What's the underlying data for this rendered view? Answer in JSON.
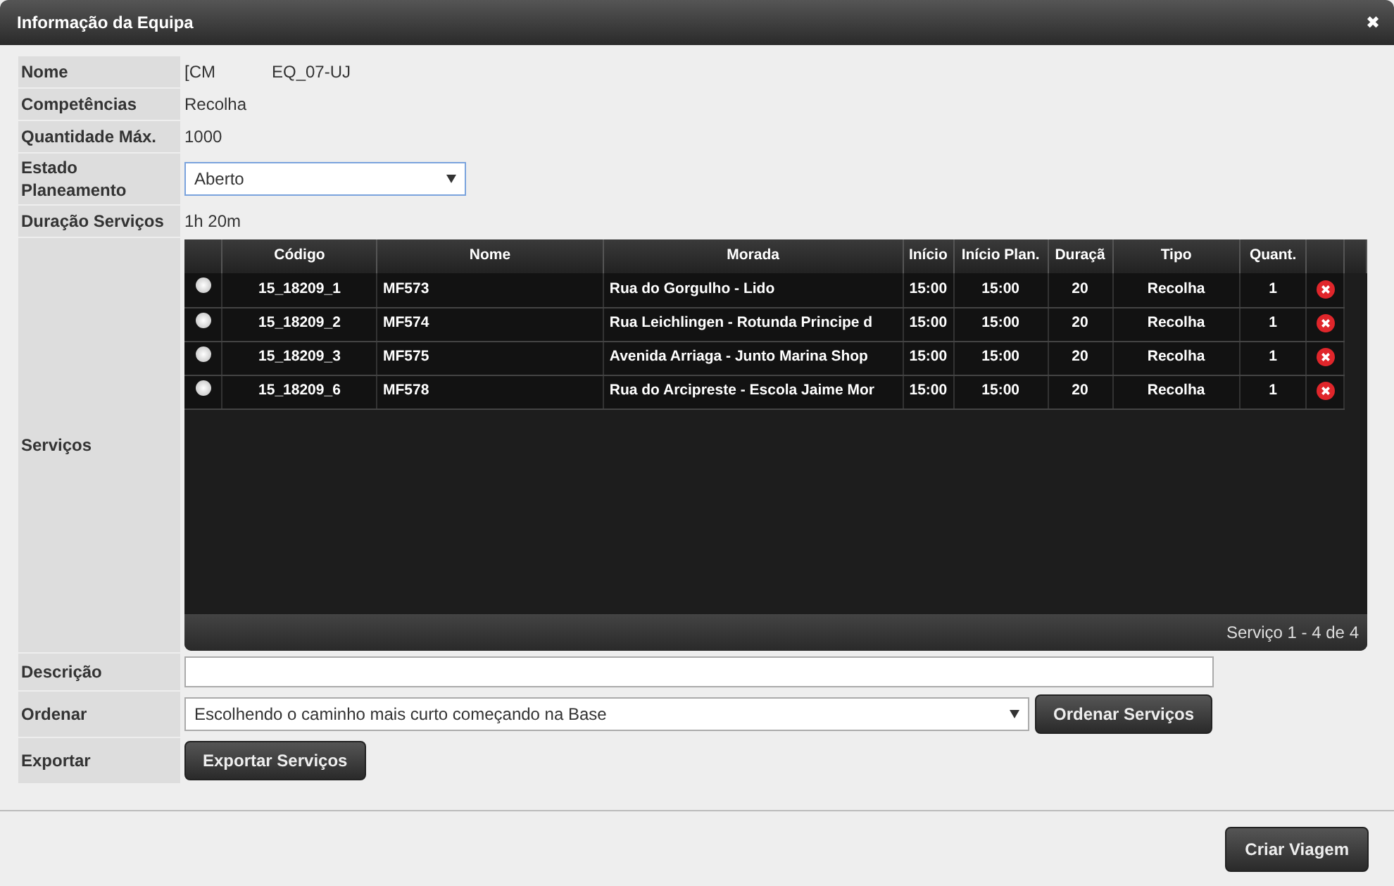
{
  "window": {
    "title": "Informação da Equipa",
    "close": "✖"
  },
  "fields": [
    {
      "label": "Nome",
      "kind": "text",
      "values": [
        "[CM",
        "EQ_07-UJ"
      ]
    },
    {
      "label": "Competências",
      "kind": "text",
      "values": [
        "Recolha"
      ]
    },
    {
      "label": "Quantidade Máx.",
      "kind": "text",
      "values": [
        "1000"
      ]
    },
    {
      "label": "Estado Planeamento",
      "kind": "select",
      "value": "Aberto"
    },
    {
      "label": "Duração Serviços",
      "kind": "text",
      "values": [
        "1h 20m"
      ]
    }
  ],
  "services": {
    "label": "Serviços",
    "columns": [
      "Código",
      "Nome",
      "Morada",
      "Início",
      "Início Plan.",
      "Duraçã",
      "Tipo",
      "Quant."
    ],
    "rows": [
      {
        "selected": false,
        "cells": [
          "15_18209_1",
          "MF573",
          "Rua do Gorgulho - Lido",
          "15:00",
          "15:00",
          "20",
          "Recolha",
          "1"
        ]
      },
      {
        "selected": false,
        "cells": [
          "15_18209_2",
          "MF574",
          "Rua Leichlingen - Rotunda Principe d",
          "15:00",
          "15:00",
          "20",
          "Recolha",
          "1"
        ]
      },
      {
        "selected": false,
        "cells": [
          "15_18209_3",
          "MF575",
          "Avenida Arriaga - Junto Marina Shop",
          "15:00",
          "15:00",
          "20",
          "Recolha",
          "1"
        ]
      },
      {
        "selected": false,
        "cells": [
          "15_18209_6",
          "MF578",
          "Rua do Arcipreste - Escola Jaime Mor",
          "15:00",
          "15:00",
          "20",
          "Recolha",
          "1"
        ]
      }
    ],
    "pager": "Serviço 1 - 4 de 4"
  },
  "description": {
    "label": "Descrição"
  },
  "order": {
    "label": "Ordenar",
    "value": "Escolhendo o caminho mais curto começando na Base",
    "button": "Ordenar Serviços"
  },
  "export": {
    "label": "Exportar",
    "button": "Exportar Serviços"
  },
  "footer": {
    "button": "Criar Viagem"
  }
}
